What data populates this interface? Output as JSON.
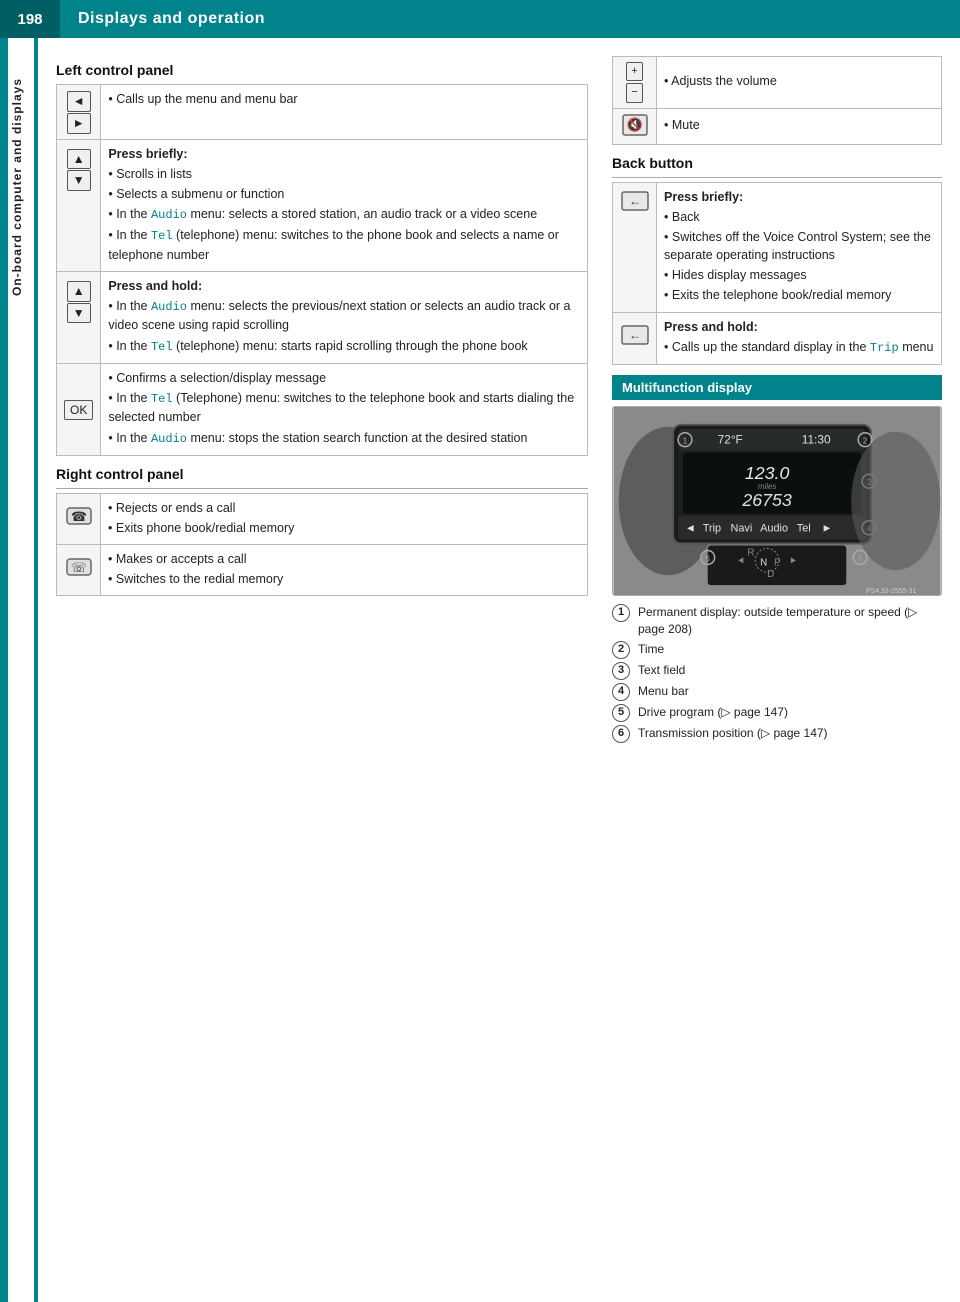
{
  "header": {
    "page_number": "198",
    "title": "Displays and operation"
  },
  "sidebar": {
    "label": "On-board computer and displays"
  },
  "left_panel": {
    "section1_heading": "Left control panel",
    "rows": [
      {
        "icon": "◄►",
        "type": "simple",
        "bullets": [
          "Calls up the menu and menu bar"
        ]
      },
      {
        "icon": "▲▼",
        "type": "press_briefly",
        "press_label": "Press briefly:",
        "bullets": [
          "Scrolls in lists",
          "Selects a submenu or function",
          "In the Audio menu: selects a stored station, an audio track or a video scene",
          "In the Tel (telephone) menu: switches to the phone book and selects a name or telephone number"
        ],
        "colored_words": [
          "Audio",
          "Tel"
        ]
      },
      {
        "icon": "▲▼",
        "type": "press_hold",
        "press_label": "Press and hold:",
        "bullets": [
          "In the Audio menu: selects the previous/next station or selects an audio track or a video scene using rapid scrolling",
          "In the Tel (telephone) menu: starts rapid scrolling through the phone book"
        ],
        "colored_words": [
          "Audio",
          "Tel"
        ]
      },
      {
        "icon": "OK",
        "type": "simple_list",
        "bullets": [
          "Confirms a selection/display message",
          "In the Tel (Telephone) menu: switches to the telephone book and starts dialing the selected number",
          "In the Audio menu: stops the station search function at the desired station"
        ],
        "colored_words": [
          "Tel",
          "Audio"
        ]
      }
    ],
    "section2_heading": "Right control panel",
    "right_rows": [
      {
        "icon": "phone_end",
        "bullets": [
          "Rejects or ends a call",
          "Exits phone book/redial memory"
        ]
      },
      {
        "icon": "phone_start",
        "bullets": [
          "Makes or accepts a call",
          "Switches to the redial memory"
        ]
      }
    ]
  },
  "right_panel": {
    "volume_rows": [
      {
        "icon": "plus_minus",
        "text": "Adjusts the volume"
      },
      {
        "icon": "mute",
        "text": "Mute"
      }
    ],
    "back_button_heading": "Back button",
    "back_rows": [
      {
        "type": "press_briefly",
        "press_label": "Press briefly:",
        "bullets": [
          "Back",
          "Switches off the Voice Control System; see the separate operating instructions",
          "Hides display messages",
          "Exits the telephone book/redial memory"
        ]
      },
      {
        "type": "press_hold",
        "press_label": "Press and hold:",
        "bullets": [
          "Calls up the standard display in the Trip menu"
        ],
        "colored_words": [
          "Trip"
        ]
      }
    ],
    "mfd_heading": "Multifunction display",
    "mfd_display": {
      "temp": "72°F",
      "time": "11:30",
      "value1": "123.0",
      "value1_label": "miles",
      "value2": "26753",
      "menu_items": [
        "Trip",
        "Navi",
        "Audio",
        "Tel"
      ],
      "gear_display": "R\nN P\nD",
      "image_ref": "PS4.33-2555-31"
    },
    "mfd_legend": [
      {
        "num": "1",
        "text": "Permanent display: outside temperature or speed (▷ page 208)"
      },
      {
        "num": "2",
        "text": "Time"
      },
      {
        "num": "3",
        "text": "Text field"
      },
      {
        "num": "4",
        "text": "Menu bar"
      },
      {
        "num": "5",
        "text": "Drive program (▷ page 147)"
      },
      {
        "num": "6",
        "text": "Transmission position (▷ page 147)"
      }
    ]
  }
}
